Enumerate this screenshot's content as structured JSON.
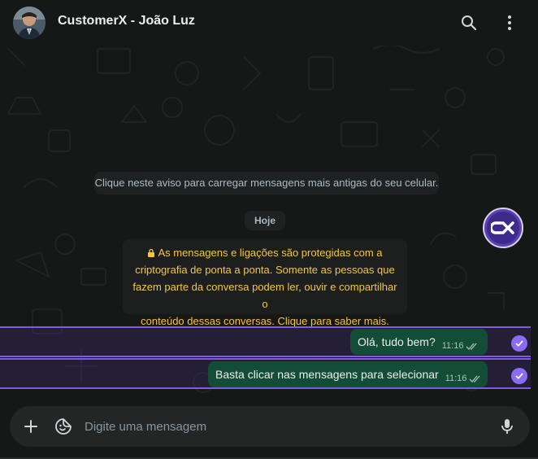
{
  "header": {
    "contact_name": "CustomerX - João Luz",
    "icons": [
      "avatar",
      "search-icon",
      "menu-dots-icon"
    ]
  },
  "notices": {
    "load_older": "Clique neste aviso para carregar mensagens mais antigas do seu celular.",
    "day": "Hoje",
    "encryption_lines": [
      "As mensagens e ligações são protegidas com a",
      "criptografia de ponta a ponta. Somente as pessoas que",
      "fazem parte da conversa podem ler, ouvir e compartilhar o",
      "conteúdo dessas conversas. Clique para saber mais."
    ]
  },
  "messages": [
    {
      "text": "Olá, tudo bem?",
      "time": "11:16",
      "status": "read",
      "selected": true
    },
    {
      "text": "Basta clicar nas mensagens para selecionar",
      "time": "11:16",
      "status": "read",
      "selected": true
    }
  ],
  "composer": {
    "placeholder": "Digite uma mensagem",
    "icons": [
      "plus-icon",
      "sticker-icon",
      "microphone-icon"
    ]
  },
  "colors": {
    "background": "#161717",
    "outgoing_bubble": "#144d37",
    "selection_accent": "#8a6cf0",
    "encryption_text": "#f5c53f"
  }
}
